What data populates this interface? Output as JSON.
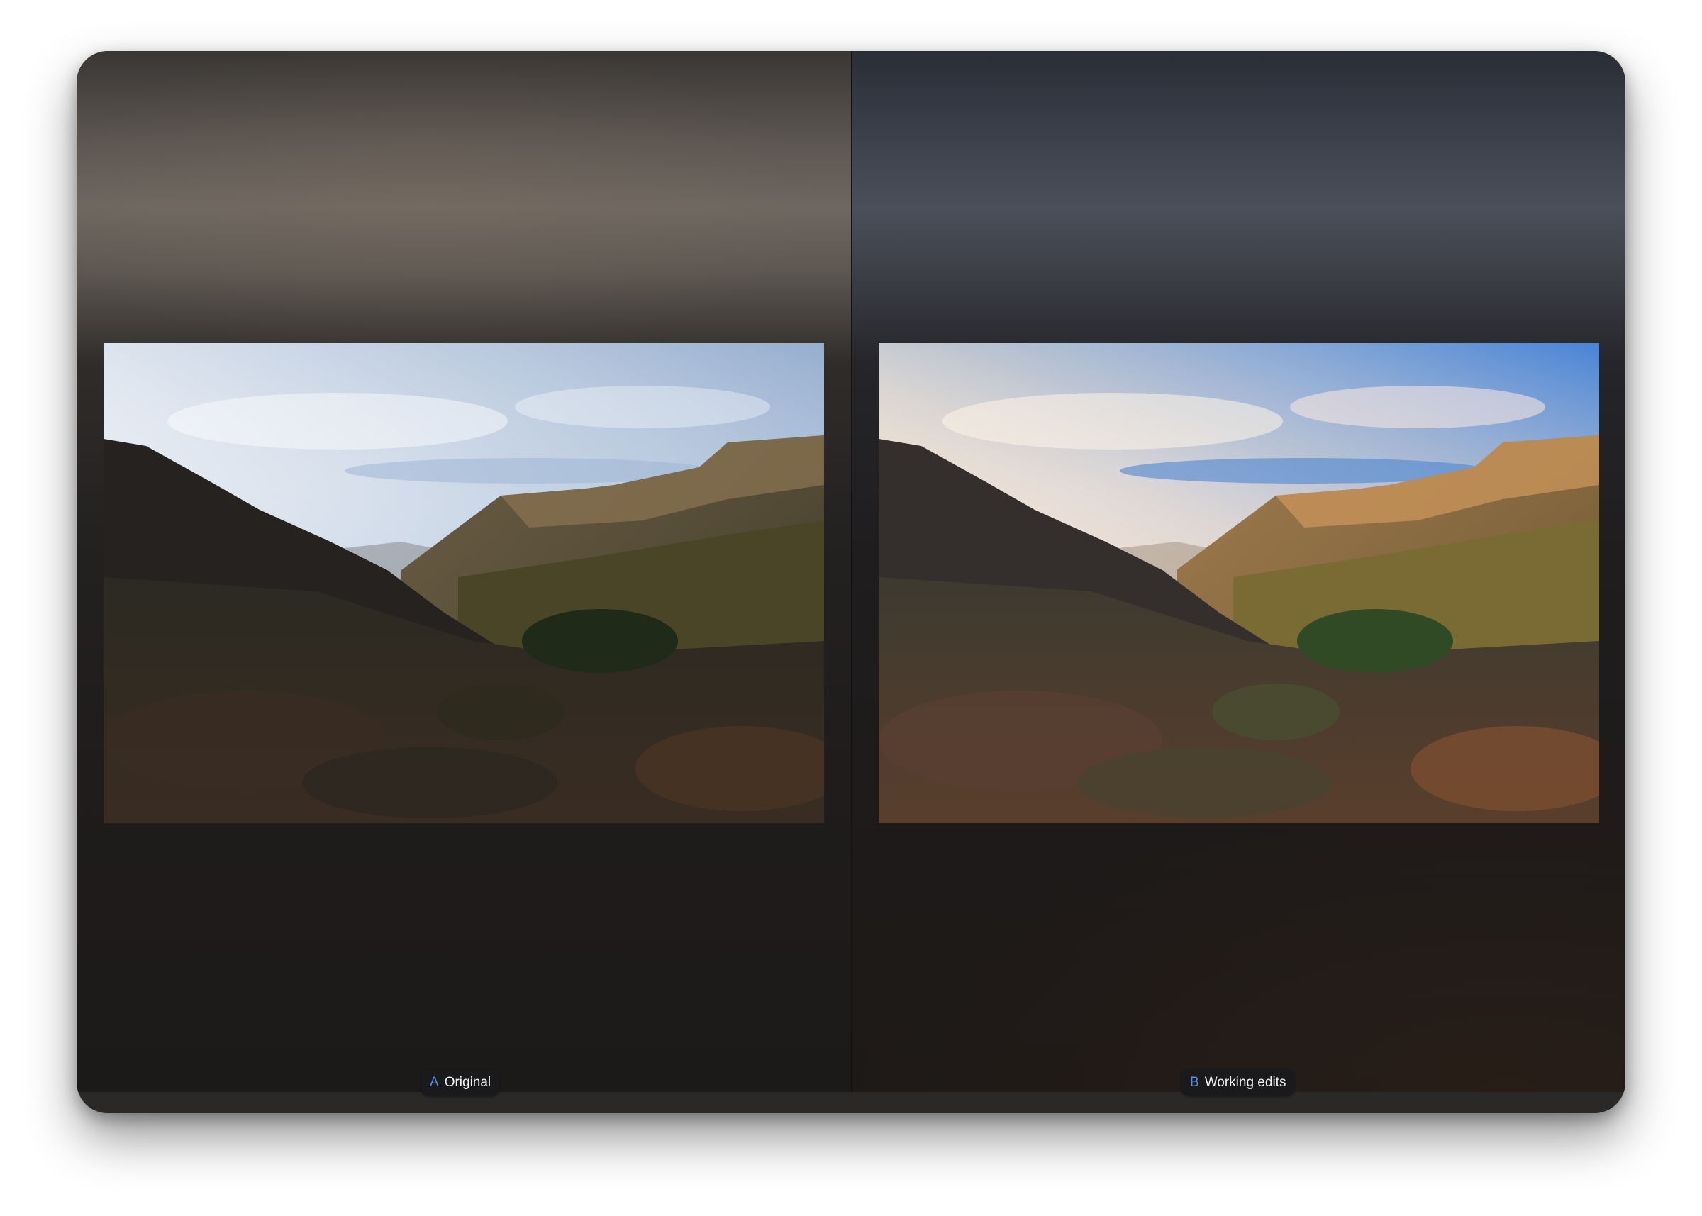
{
  "panes": [
    {
      "letter": "A",
      "title": "Original"
    },
    {
      "letter": "B",
      "title": "Working edits"
    }
  ],
  "colors": {
    "label_letter": "#5b8fe0",
    "label_text": "#f2f2f2",
    "label_bg": "#1a1a1c"
  }
}
